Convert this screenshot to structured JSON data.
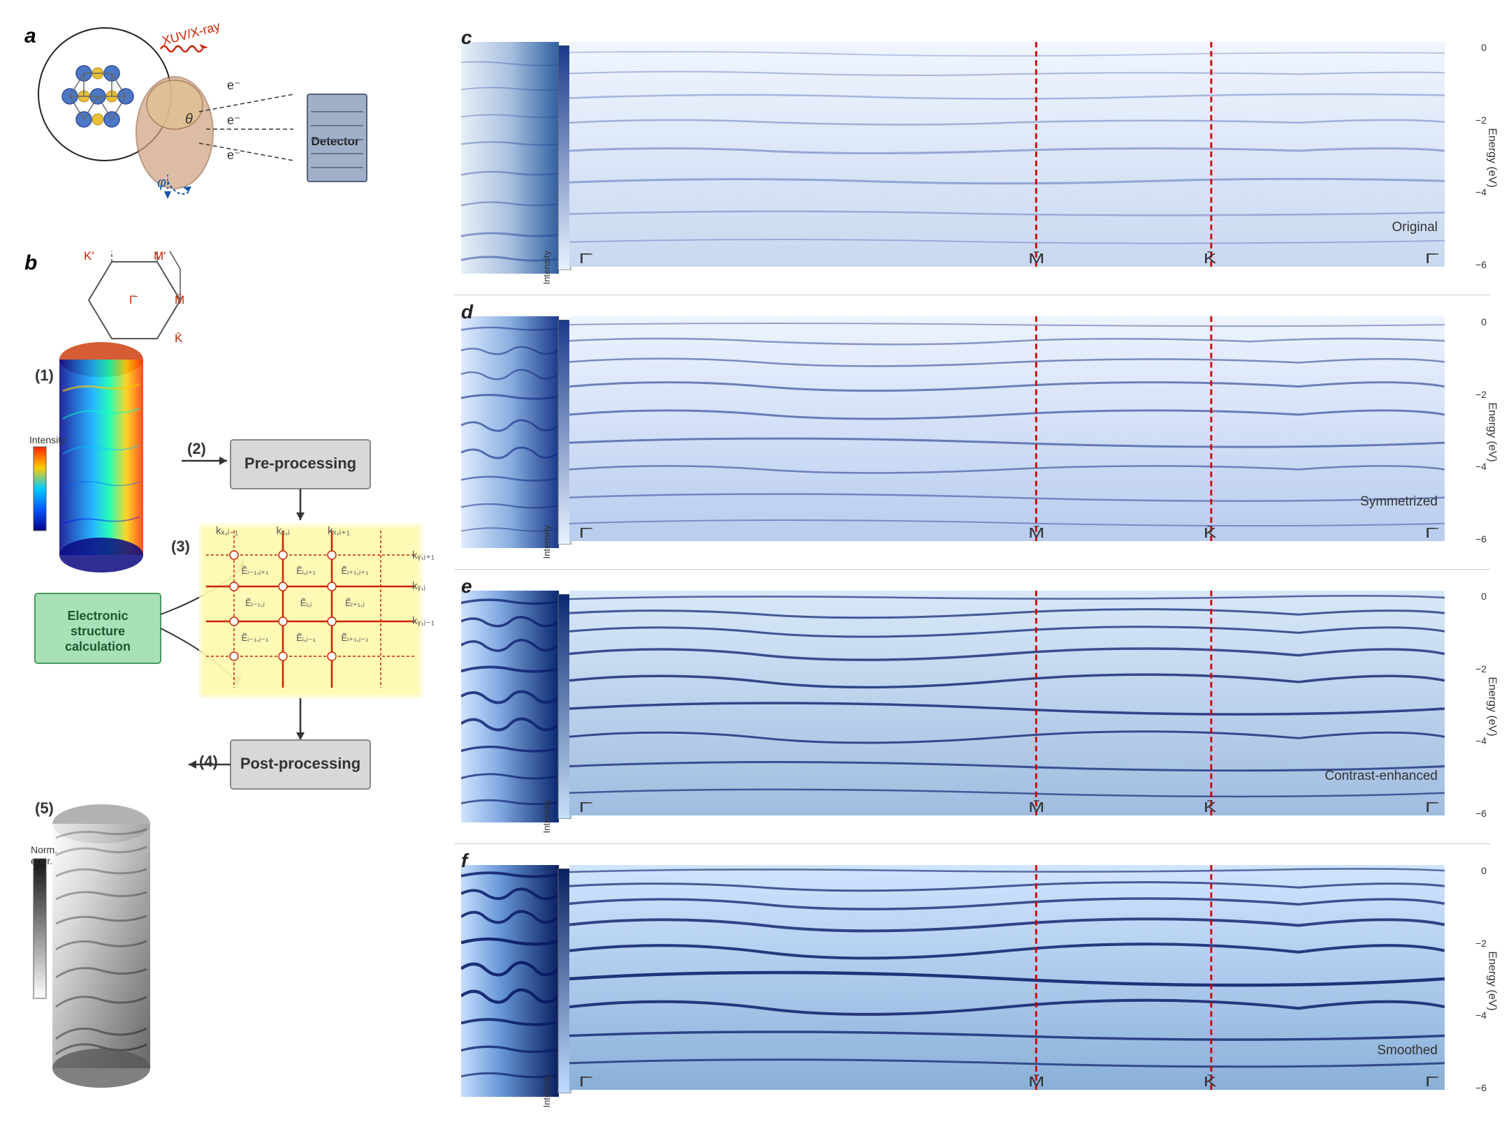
{
  "panels": {
    "a": {
      "label": "a",
      "xuv_label": "XUV/X-ray",
      "detector_label": "Detector",
      "electron_labels": [
        "e⁻",
        "e⁻",
        "e⁻"
      ],
      "angles": [
        "θ",
        "φ"
      ]
    },
    "b": {
      "label": "b",
      "steps": {
        "s1": "(1)",
        "s2": "(2)",
        "s3": "(3)",
        "s4": "(4)",
        "s5": "(5)"
      },
      "preprocessing": "Pre-processing",
      "postprocessing": "Post-processing",
      "electronic_calc": "Electronic\nstructure\ncalculation",
      "intensity_label": "Intensity",
      "norm_ener_label": "Norm.\nener.",
      "bz_points": [
        "K̄'",
        "M̄'",
        "Γ̄",
        "M̄",
        "K̄"
      ],
      "grid_labels": {
        "kx_labels": [
          "kₓ,ᵢ₋₁",
          "kₓ,ᵢ",
          "kₓ,ᵢ₊₁"
        ],
        "ky_labels": [
          "k_y,j+1",
          "k_y,j",
          "k_y,j-1"
        ],
        "E_labels": [
          "Ẽᵢ₋₁,ⱼ₊₁",
          "Ẽᵢ,ⱼ₊₁",
          "Ẽᵢ₊₁,ⱼ₊₁",
          "Ẽᵢ₋₁,ⱼ",
          "Ẽᵢ,ⱼ",
          "Ẽᵢ₊₁,ⱼ",
          "Ẽᵢ₋₁,ⱼ₋₁",
          "Ẽᵢ,ⱼ₋₁",
          "Ẽᵢ₊₁,ⱼ₋₁"
        ]
      }
    },
    "c": {
      "label": "c",
      "title": "Original",
      "energy_ticks": [
        "0",
        "-2",
        "-4",
        "-6"
      ],
      "k_labels": [
        "Γ̄",
        "M̄",
        "K̄",
        "Γ̄"
      ],
      "energy_axis_title": "Energy (eV)",
      "intensity_label": "Intensity"
    },
    "d": {
      "label": "d",
      "title": "Symmetrized",
      "energy_ticks": [
        "0",
        "-2",
        "-4",
        "-6"
      ],
      "k_labels": [
        "Γ̄",
        "M̄",
        "K̄",
        "Γ̄"
      ],
      "energy_axis_title": "Energy (eV)",
      "intensity_label": "Intensity"
    },
    "e": {
      "label": "e",
      "title": "Contrast-enhanced",
      "energy_ticks": [
        "0",
        "-2",
        "-4",
        "-6"
      ],
      "k_labels": [
        "Γ̄",
        "M̄",
        "K̄",
        "Γ̄"
      ],
      "energy_axis_title": "Energy (eV)",
      "intensity_label": "Intensity"
    },
    "f": {
      "label": "f",
      "title": "Smoothed",
      "energy_ticks": [
        "0",
        "-2",
        "-4",
        "-6"
      ],
      "k_labels": [
        "Γ̄",
        "M̄",
        "K̄",
        "Γ̄"
      ],
      "energy_axis_title": "Energy (eV)",
      "intensity_label": "Intensity"
    }
  },
  "colors": {
    "background": "#ffffff",
    "blue_dark": "#1a3a8a",
    "blue_light": "#dce8f8",
    "green_box": "#a8e0b8",
    "gray_box": "#d8d8d8",
    "red_dashed": "#cc0000",
    "arpes_hot": [
      "#000080",
      "#0000ff",
      "#00ffff",
      "#ffff00",
      "#ff8800",
      "#ff0000"
    ],
    "arpes_blue": [
      "#dce8f8",
      "#aac4e8",
      "#5588c8",
      "#1a3a8a"
    ],
    "gradient_gray": [
      "#ffffff",
      "#888888",
      "#000000"
    ]
  }
}
